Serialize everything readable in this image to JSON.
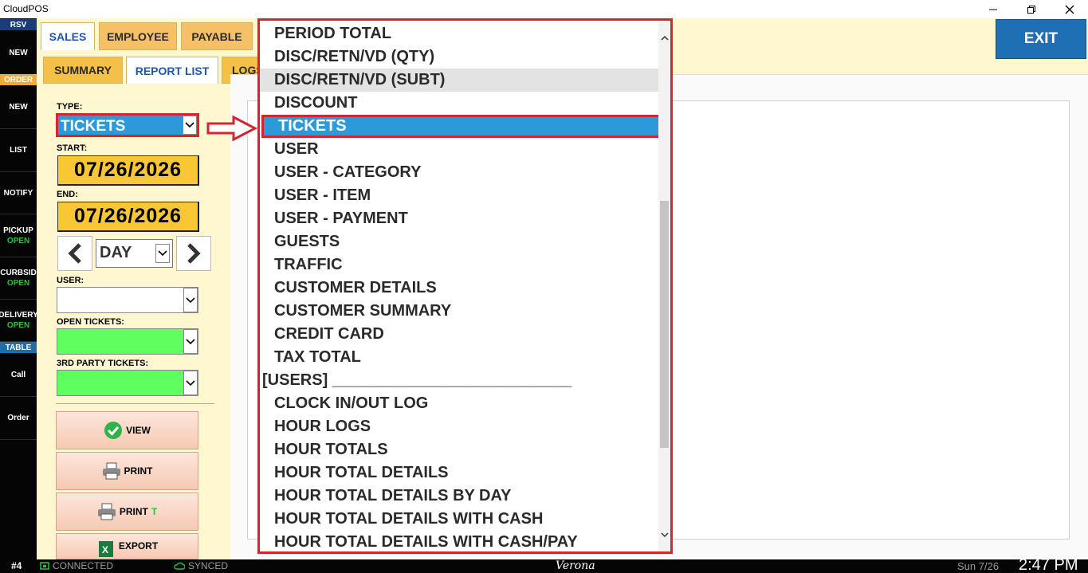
{
  "window": {
    "title": "CloudPOS",
    "minimize_icon": "minimize-icon",
    "restore_icon": "restore-icon",
    "close_icon": "close-icon"
  },
  "sidebar": {
    "rsv_header": "RSV",
    "order_header": "ORDER",
    "table_header": "TABLE",
    "items": [
      {
        "label": "NEW",
        "sub": ""
      },
      {
        "label": "NEW",
        "sub": ""
      },
      {
        "label": "LIST",
        "sub": ""
      },
      {
        "label": "NOTIFY",
        "sub": ""
      },
      {
        "label": "PICKUP",
        "sub": "OPEN"
      },
      {
        "label": "CURBSID",
        "sub": "OPEN"
      },
      {
        "label": "DELIVERY",
        "sub": "OPEN"
      },
      {
        "label": "Call",
        "sub": ""
      },
      {
        "label": "Order",
        "sub": ""
      }
    ]
  },
  "tabs": {
    "top": [
      "SALES",
      "EMPLOYEE",
      "PAYABLE"
    ],
    "sub": [
      "SUMMARY",
      "REPORT LIST",
      "LOGS"
    ]
  },
  "exit_label": "EXIT",
  "filters": {
    "type_label": "TYPE:",
    "type_value": "TICKETS",
    "start_label": "START:",
    "start_date": "07/26/2026",
    "end_label": "END:",
    "end_date": "07/26/2026",
    "period_value": "DAY",
    "user_label": "USER:",
    "user_value": "",
    "open_tickets_label": "OPEN TICKETS:",
    "third_party_label": "3RD PARTY TICKETS:"
  },
  "actions": {
    "view": "VIEW",
    "print": "PRINT",
    "print_t_prefix": "PRINT",
    "print_t_suffix": "T",
    "export": "EXPORT"
  },
  "dropdown": {
    "items": [
      {
        "label": "PERIOD TOTAL",
        "state": "normal"
      },
      {
        "label": "DISC/RETN/VD (QTY)",
        "state": "normal"
      },
      {
        "label": "DISC/RETN/VD (SUBT)",
        "state": "hover"
      },
      {
        "label": "DISCOUNT",
        "state": "normal"
      },
      {
        "label": "TICKETS",
        "state": "selected"
      },
      {
        "label": "USER",
        "state": "normal"
      },
      {
        "label": "USER - CATEGORY",
        "state": "normal"
      },
      {
        "label": "USER - ITEM",
        "state": "normal"
      },
      {
        "label": "USER - PAYMENT",
        "state": "normal"
      },
      {
        "label": "GUESTS",
        "state": "normal"
      },
      {
        "label": "TRAFFIC",
        "state": "normal"
      },
      {
        "label": "CUSTOMER DETAILS",
        "state": "normal"
      },
      {
        "label": "CUSTOMER SUMMARY",
        "state": "normal"
      },
      {
        "label": "CREDIT CARD",
        "state": "normal"
      },
      {
        "label": "TAX TOTAL",
        "state": "normal"
      },
      {
        "label": "[USERS] ___________________________",
        "state": "header"
      },
      {
        "label": "CLOCK IN/OUT LOG",
        "state": "normal"
      },
      {
        "label": "HOUR LOGS",
        "state": "normal"
      },
      {
        "label": "HOUR TOTALS",
        "state": "normal"
      },
      {
        "label": "HOUR TOTAL DETAILS",
        "state": "normal"
      },
      {
        "label": "HOUR TOTAL DETAILS BY DAY",
        "state": "normal"
      },
      {
        "label": "HOUR TOTAL DETAILS WITH CASH",
        "state": "normal"
      },
      {
        "label": "HOUR TOTAL DETAILS WITH CASH/PAY",
        "state": "normal"
      }
    ]
  },
  "status": {
    "station": "#4",
    "connected": "CONNECTED",
    "synced": "SYNCED",
    "location": "Verona",
    "date": "Sun 7/26",
    "time": "2:47 PM"
  },
  "colors": {
    "accent_blue": "#2c9ad8",
    "highlight_red": "#d72431",
    "date_yellow": "#f9c734",
    "open_green": "#23c832"
  }
}
